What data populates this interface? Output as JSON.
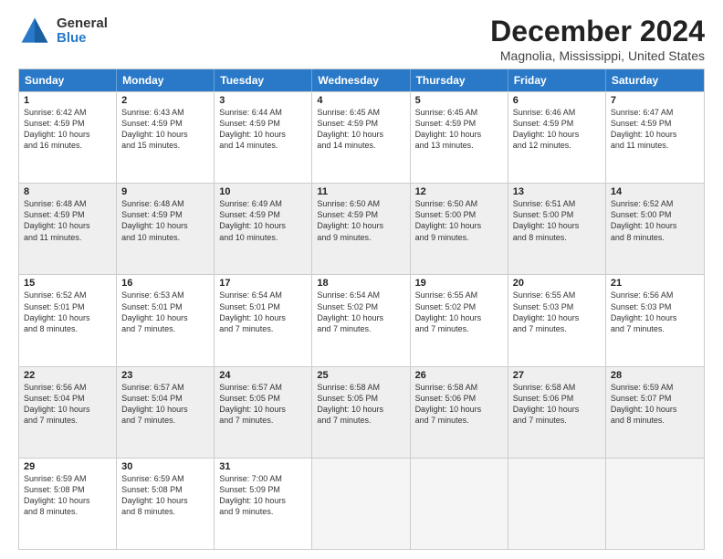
{
  "logo": {
    "general": "General",
    "blue": "Blue"
  },
  "title": "December 2024",
  "subtitle": "Magnolia, Mississippi, United States",
  "days": [
    "Sunday",
    "Monday",
    "Tuesday",
    "Wednesday",
    "Thursday",
    "Friday",
    "Saturday"
  ],
  "weeks": [
    [
      {
        "day": "1",
        "text": "Sunrise: 6:42 AM\nSunset: 4:59 PM\nDaylight: 10 hours\nand 16 minutes."
      },
      {
        "day": "2",
        "text": "Sunrise: 6:43 AM\nSunset: 4:59 PM\nDaylight: 10 hours\nand 15 minutes."
      },
      {
        "day": "3",
        "text": "Sunrise: 6:44 AM\nSunset: 4:59 PM\nDaylight: 10 hours\nand 14 minutes."
      },
      {
        "day": "4",
        "text": "Sunrise: 6:45 AM\nSunset: 4:59 PM\nDaylight: 10 hours\nand 14 minutes."
      },
      {
        "day": "5",
        "text": "Sunrise: 6:45 AM\nSunset: 4:59 PM\nDaylight: 10 hours\nand 13 minutes."
      },
      {
        "day": "6",
        "text": "Sunrise: 6:46 AM\nSunset: 4:59 PM\nDaylight: 10 hours\nand 12 minutes."
      },
      {
        "day": "7",
        "text": "Sunrise: 6:47 AM\nSunset: 4:59 PM\nDaylight: 10 hours\nand 11 minutes."
      }
    ],
    [
      {
        "day": "8",
        "text": "Sunrise: 6:48 AM\nSunset: 4:59 PM\nDaylight: 10 hours\nand 11 minutes."
      },
      {
        "day": "9",
        "text": "Sunrise: 6:48 AM\nSunset: 4:59 PM\nDaylight: 10 hours\nand 10 minutes."
      },
      {
        "day": "10",
        "text": "Sunrise: 6:49 AM\nSunset: 4:59 PM\nDaylight: 10 hours\nand 10 minutes."
      },
      {
        "day": "11",
        "text": "Sunrise: 6:50 AM\nSunset: 4:59 PM\nDaylight: 10 hours\nand 9 minutes."
      },
      {
        "day": "12",
        "text": "Sunrise: 6:50 AM\nSunset: 5:00 PM\nDaylight: 10 hours\nand 9 minutes."
      },
      {
        "day": "13",
        "text": "Sunrise: 6:51 AM\nSunset: 5:00 PM\nDaylight: 10 hours\nand 8 minutes."
      },
      {
        "day": "14",
        "text": "Sunrise: 6:52 AM\nSunset: 5:00 PM\nDaylight: 10 hours\nand 8 minutes."
      }
    ],
    [
      {
        "day": "15",
        "text": "Sunrise: 6:52 AM\nSunset: 5:01 PM\nDaylight: 10 hours\nand 8 minutes."
      },
      {
        "day": "16",
        "text": "Sunrise: 6:53 AM\nSunset: 5:01 PM\nDaylight: 10 hours\nand 7 minutes."
      },
      {
        "day": "17",
        "text": "Sunrise: 6:54 AM\nSunset: 5:01 PM\nDaylight: 10 hours\nand 7 minutes."
      },
      {
        "day": "18",
        "text": "Sunrise: 6:54 AM\nSunset: 5:02 PM\nDaylight: 10 hours\nand 7 minutes."
      },
      {
        "day": "19",
        "text": "Sunrise: 6:55 AM\nSunset: 5:02 PM\nDaylight: 10 hours\nand 7 minutes."
      },
      {
        "day": "20",
        "text": "Sunrise: 6:55 AM\nSunset: 5:03 PM\nDaylight: 10 hours\nand 7 minutes."
      },
      {
        "day": "21",
        "text": "Sunrise: 6:56 AM\nSunset: 5:03 PM\nDaylight: 10 hours\nand 7 minutes."
      }
    ],
    [
      {
        "day": "22",
        "text": "Sunrise: 6:56 AM\nSunset: 5:04 PM\nDaylight: 10 hours\nand 7 minutes."
      },
      {
        "day": "23",
        "text": "Sunrise: 6:57 AM\nSunset: 5:04 PM\nDaylight: 10 hours\nand 7 minutes."
      },
      {
        "day": "24",
        "text": "Sunrise: 6:57 AM\nSunset: 5:05 PM\nDaylight: 10 hours\nand 7 minutes."
      },
      {
        "day": "25",
        "text": "Sunrise: 6:58 AM\nSunset: 5:05 PM\nDaylight: 10 hours\nand 7 minutes."
      },
      {
        "day": "26",
        "text": "Sunrise: 6:58 AM\nSunset: 5:06 PM\nDaylight: 10 hours\nand 7 minutes."
      },
      {
        "day": "27",
        "text": "Sunrise: 6:58 AM\nSunset: 5:06 PM\nDaylight: 10 hours\nand 7 minutes."
      },
      {
        "day": "28",
        "text": "Sunrise: 6:59 AM\nSunset: 5:07 PM\nDaylight: 10 hours\nand 8 minutes."
      }
    ],
    [
      {
        "day": "29",
        "text": "Sunrise: 6:59 AM\nSunset: 5:08 PM\nDaylight: 10 hours\nand 8 minutes."
      },
      {
        "day": "30",
        "text": "Sunrise: 6:59 AM\nSunset: 5:08 PM\nDaylight: 10 hours\nand 8 minutes."
      },
      {
        "day": "31",
        "text": "Sunrise: 7:00 AM\nSunset: 5:09 PM\nDaylight: 10 hours\nand 9 minutes."
      },
      {
        "day": "",
        "text": ""
      },
      {
        "day": "",
        "text": ""
      },
      {
        "day": "",
        "text": ""
      },
      {
        "day": "",
        "text": ""
      }
    ]
  ]
}
